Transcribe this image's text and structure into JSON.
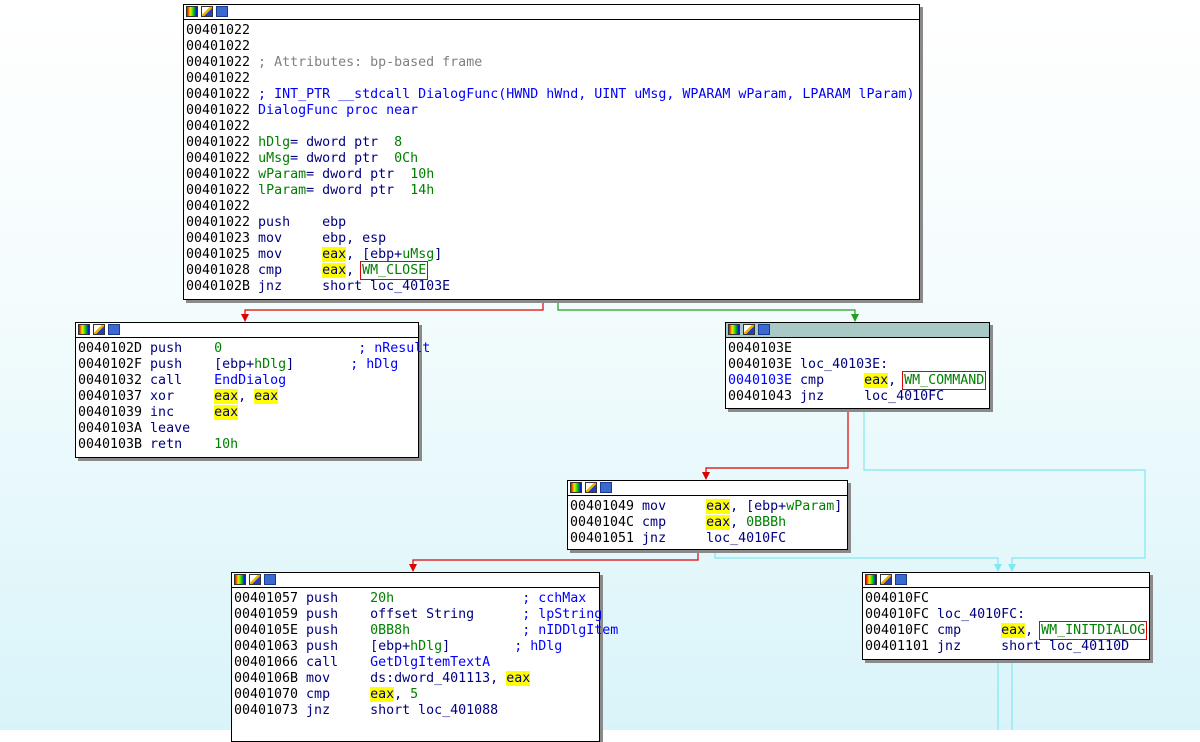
{
  "view": "ida-graph-view",
  "colors": {
    "true_edge": "#00a000",
    "false_edge": "#e00000",
    "jump_edge": "#80e8f0",
    "highlight": "#ffff00",
    "box": "#e00000"
  },
  "header_icons": [
    "color-palette-icon",
    "edit-icon",
    "graph-overview-icon"
  ],
  "blocks": [
    {
      "id": "b401022",
      "lines": [
        [
          [
            "00401022",
            "a"
          ]
        ],
        [
          [
            "00401022",
            "a"
          ]
        ],
        [
          [
            "00401022",
            "a"
          ],
          [
            " ; Attributes: bp-based frame",
            "c"
          ]
        ],
        [
          [
            "00401022",
            "a"
          ]
        ],
        [
          [
            "00401022",
            "a"
          ],
          [
            " ; INT_PTR __stdcall DialogFunc(HWND hWnd, UINT uMsg, WPARAM wParam, LPARAM lParam)",
            "b"
          ]
        ],
        [
          [
            "00401022",
            "a"
          ],
          [
            " DialogFunc proc near",
            "b"
          ]
        ],
        [
          [
            "00401022",
            "a"
          ]
        ],
        [
          [
            "00401022",
            "a"
          ],
          [
            " ",
            "k"
          ],
          [
            "hDlg",
            "g"
          ],
          [
            "= dword ptr  ",
            "k"
          ],
          [
            "8",
            "g"
          ]
        ],
        [
          [
            "00401022",
            "a"
          ],
          [
            " ",
            "k"
          ],
          [
            "uMsg",
            "g"
          ],
          [
            "= dword ptr  ",
            "k"
          ],
          [
            "0Ch",
            "g"
          ]
        ],
        [
          [
            "00401022",
            "a"
          ],
          [
            " ",
            "k"
          ],
          [
            "wParam",
            "g"
          ],
          [
            "= dword ptr  ",
            "k"
          ],
          [
            "10h",
            "g"
          ]
        ],
        [
          [
            "00401022",
            "a"
          ],
          [
            " ",
            "k"
          ],
          [
            "lParam",
            "g"
          ],
          [
            "= dword ptr  ",
            "k"
          ],
          [
            "14h",
            "g"
          ]
        ],
        [
          [
            "00401022",
            "a"
          ]
        ],
        [
          [
            "00401022",
            "a"
          ],
          [
            " push    ebp",
            "k"
          ]
        ],
        [
          [
            "00401023",
            "a"
          ],
          [
            " mov     ebp, esp",
            "k"
          ]
        ],
        [
          [
            "00401025",
            "a"
          ],
          [
            " mov     ",
            "k"
          ],
          [
            "eax",
            "y"
          ],
          [
            ", [ebp+",
            "k"
          ],
          [
            "uMsg",
            "g"
          ],
          [
            "]",
            "k"
          ]
        ],
        [
          [
            "00401028",
            "a"
          ],
          [
            " cmp     ",
            "k"
          ],
          [
            "eax",
            "y"
          ],
          [
            ", ",
            "k"
          ],
          [
            "WM_CLOSE",
            "g r"
          ]
        ],
        [
          [
            "0040102B",
            "a"
          ],
          [
            " jnz     short loc_40103E",
            "k"
          ]
        ]
      ]
    },
    {
      "id": "b40102D",
      "lines": [
        [
          [
            "0040102D",
            "a"
          ],
          [
            " push    ",
            "k"
          ],
          [
            "0",
            "g"
          ],
          [
            "                 ",
            "k"
          ],
          [
            "; nResult",
            "ca"
          ]
        ],
        [
          [
            "0040102F",
            "a"
          ],
          [
            " push    [ebp+",
            "k"
          ],
          [
            "hDlg",
            "g"
          ],
          [
            "]       ",
            "k"
          ],
          [
            "; hDlg",
            "ca"
          ]
        ],
        [
          [
            "00401032",
            "a"
          ],
          [
            " call    ",
            "k"
          ],
          [
            "EndDialog",
            "b"
          ]
        ],
        [
          [
            "00401037",
            "a"
          ],
          [
            " xor     ",
            "k"
          ],
          [
            "eax",
            "y"
          ],
          [
            ", ",
            "k"
          ],
          [
            "eax",
            "y"
          ]
        ],
        [
          [
            "00401039",
            "a"
          ],
          [
            " inc     ",
            "k"
          ],
          [
            "eax",
            "y"
          ]
        ],
        [
          [
            "0040103A",
            "a"
          ],
          [
            " leave",
            "k"
          ]
        ],
        [
          [
            "0040103B",
            "a"
          ],
          [
            " retn    ",
            "k"
          ],
          [
            "10h",
            "g"
          ]
        ]
      ]
    },
    {
      "id": "b40103E",
      "selected": true,
      "lines": [
        [
          [
            "0040103E",
            "a"
          ]
        ],
        [
          [
            "0040103E",
            "a"
          ],
          [
            " loc_40103E:",
            "k"
          ]
        ],
        [
          [
            "0040103E",
            "b"
          ],
          [
            " cmp     ",
            "k"
          ],
          [
            "eax",
            "y"
          ],
          [
            ", ",
            "k"
          ],
          [
            "WM_COMMAND",
            "g r"
          ]
        ],
        [
          [
            "00401043",
            "a"
          ],
          [
            " jnz     loc_4010FC",
            "k"
          ]
        ]
      ]
    },
    {
      "id": "b401049",
      "lines": [
        [
          [
            "00401049",
            "a"
          ],
          [
            " mov     ",
            "k"
          ],
          [
            "eax",
            "y"
          ],
          [
            ", [ebp+",
            "k"
          ],
          [
            "wParam",
            "g"
          ],
          [
            "]",
            "k"
          ]
        ],
        [
          [
            "0040104C",
            "a"
          ],
          [
            " cmp     ",
            "k"
          ],
          [
            "eax",
            "y"
          ],
          [
            ", ",
            "k"
          ],
          [
            "0BBBh",
            "g"
          ]
        ],
        [
          [
            "00401051",
            "a"
          ],
          [
            " jnz     loc_4010FC",
            "k"
          ]
        ]
      ]
    },
    {
      "id": "b401057",
      "lines": [
        [
          [
            "00401057",
            "a"
          ],
          [
            " push    ",
            "k"
          ],
          [
            "20h",
            "g"
          ],
          [
            "                ",
            "k"
          ],
          [
            "; cchMax",
            "ca"
          ]
        ],
        [
          [
            "00401059",
            "a"
          ],
          [
            " push    offset String      ",
            "k"
          ],
          [
            "; lpString",
            "ca"
          ]
        ],
        [
          [
            "0040105E",
            "a"
          ],
          [
            " push    ",
            "k"
          ],
          [
            "0BB8h",
            "g"
          ],
          [
            "              ",
            "k"
          ],
          [
            "; nIDDlgItem",
            "ca"
          ]
        ],
        [
          [
            "00401063",
            "a"
          ],
          [
            " push    [ebp+",
            "k"
          ],
          [
            "hDlg",
            "g"
          ],
          [
            "]        ",
            "k"
          ],
          [
            "; hDlg",
            "ca"
          ]
        ],
        [
          [
            "00401066",
            "a"
          ],
          [
            " call    ",
            "k"
          ],
          [
            "GetDlgItemTextA",
            "b"
          ]
        ],
        [
          [
            "0040106B",
            "a"
          ],
          [
            " mov     ds:dword_401113, ",
            "k"
          ],
          [
            "eax",
            "y"
          ]
        ],
        [
          [
            "00401070",
            "a"
          ],
          [
            " cmp     ",
            "k"
          ],
          [
            "eax",
            "y"
          ],
          [
            ", ",
            "k"
          ],
          [
            "5",
            "g"
          ]
        ],
        [
          [
            "00401073",
            "a"
          ],
          [
            " jnz     short loc_401088",
            "k"
          ]
        ]
      ]
    },
    {
      "id": "b4010FC",
      "lines": [
        [
          [
            "004010FC",
            "a"
          ]
        ],
        [
          [
            "004010FC",
            "a"
          ],
          [
            " loc_4010FC:",
            "k"
          ]
        ],
        [
          [
            "004010FC",
            "a"
          ],
          [
            " cmp     ",
            "k"
          ],
          [
            "eax",
            "y"
          ],
          [
            ", ",
            "k"
          ],
          [
            "WM_INITDIALOG",
            "g r"
          ]
        ],
        [
          [
            "00401101",
            "a"
          ],
          [
            " jnz     short loc_40110D",
            "k"
          ]
        ]
      ]
    }
  ]
}
